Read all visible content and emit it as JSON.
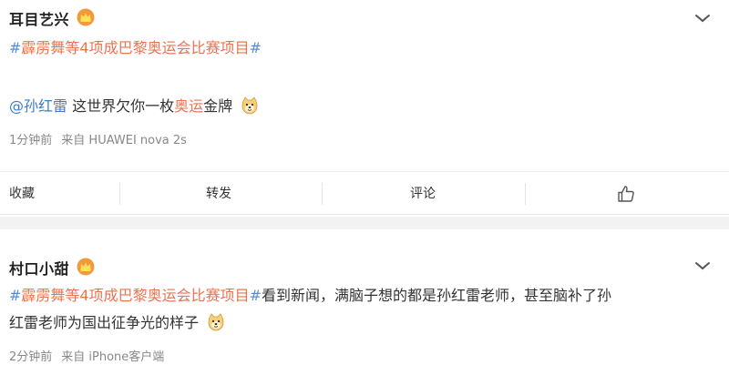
{
  "posts": [
    {
      "username": "耳目艺兴",
      "line1": {
        "hash_open": "#",
        "topic": "霹雳舞等4项成巴黎奥运会比赛项目",
        "hash_close": "#"
      },
      "line2": {
        "mention": "@孙红雷",
        "text_a": " 这世界欠你一枚",
        "highlight": "奥运",
        "text_b": "金牌"
      },
      "time": "1分钟前",
      "source": "来自 HUAWEI nova 2s"
    },
    {
      "username": "村口小甜",
      "line1": {
        "hash_open": "#",
        "topic": "霹雳舞等4项成巴黎奥运会比赛项目",
        "hash_close": "#",
        "text": "看到新闻，满脑子想的都是孙红雷老师，甚至脑补了孙"
      },
      "line2": {
        "text": "红雷老师为国出征争光的样子"
      },
      "time": "2分钟前",
      "source": "来自 iPhone客户端"
    }
  ],
  "actions": {
    "favorite": "收藏",
    "repost": "转发",
    "comment": "评论"
  },
  "icons": {
    "crown": "crown-icon",
    "chevron": "chevron-down-icon",
    "emoji": "doge-emoji-icon",
    "like": "thumbs-up-icon"
  },
  "colors": {
    "topic": "#eb7350",
    "hash": "#5b8ed1",
    "mention": "#3f7cc7",
    "meta": "#888888",
    "separator": "#f2f2f2"
  }
}
